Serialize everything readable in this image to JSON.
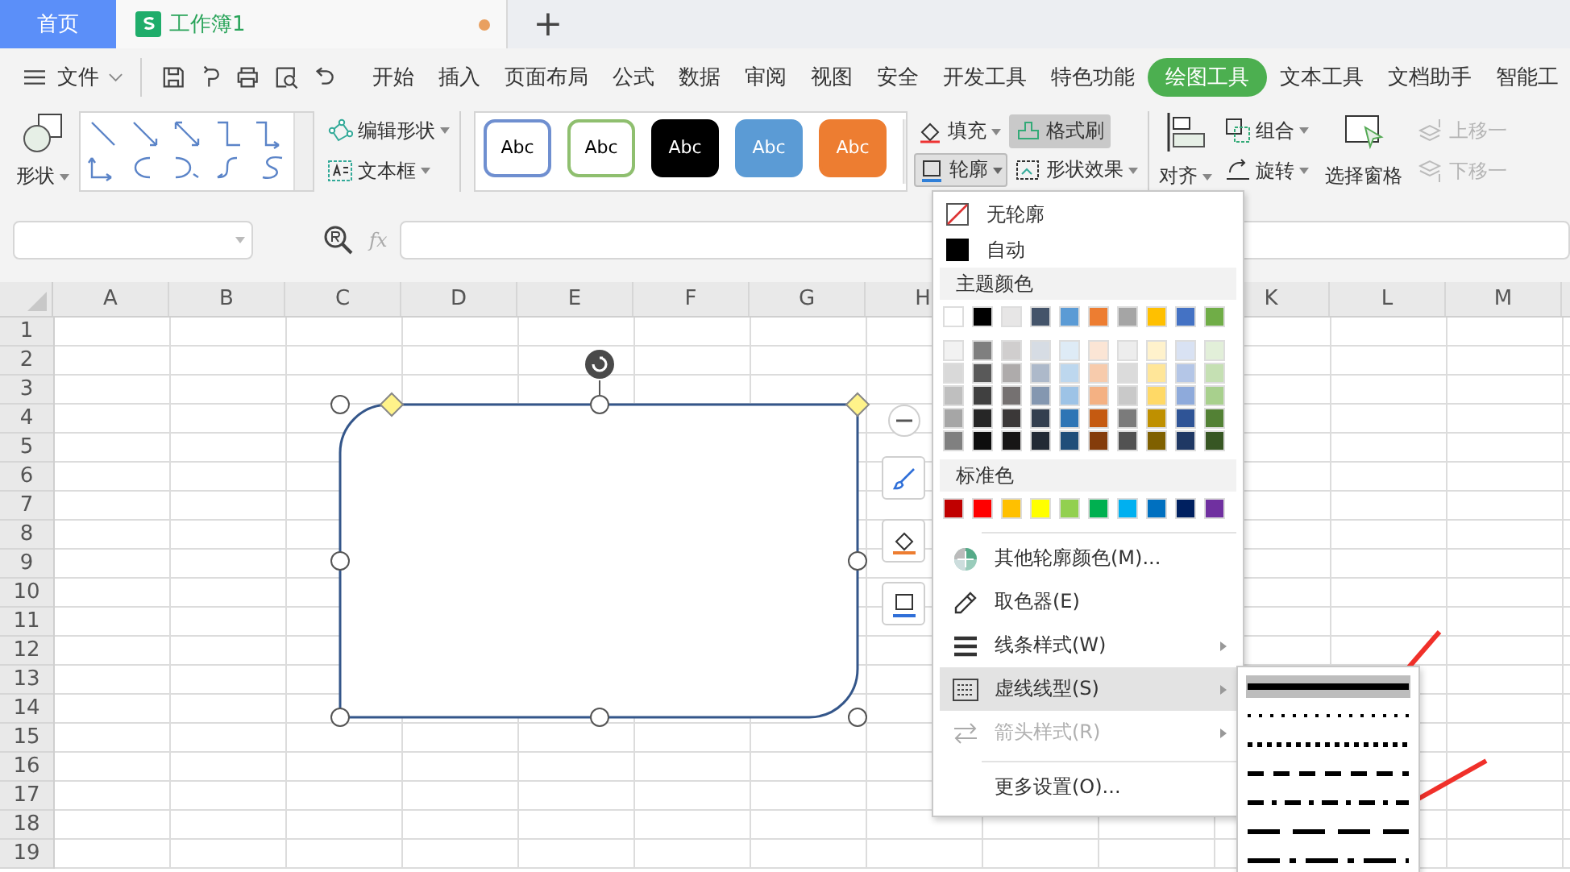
{
  "tabs": [
    {
      "label": "首页",
      "kind": "home",
      "selected": false
    },
    {
      "label": "工作簿1",
      "kind": "doc",
      "selected": true,
      "unsaved": true
    }
  ],
  "new_tab": "+",
  "menu": {
    "file": "文件",
    "items": [
      {
        "label": "开始",
        "selected": false
      },
      {
        "label": "插入",
        "selected": false
      },
      {
        "label": "页面布局",
        "selected": false
      },
      {
        "label": "公式",
        "selected": false
      },
      {
        "label": "数据",
        "selected": false
      },
      {
        "label": "审阅",
        "selected": false
      },
      {
        "label": "视图",
        "selected": false
      },
      {
        "label": "安全",
        "selected": false
      },
      {
        "label": "开发工具",
        "selected": false
      },
      {
        "label": "特色功能",
        "selected": false
      },
      {
        "label": "绘图工具",
        "selected": true
      },
      {
        "label": "文本工具",
        "selected": false
      },
      {
        "label": "文档助手",
        "selected": false
      },
      {
        "label": "智能工",
        "selected": false
      }
    ]
  },
  "ribbon": {
    "shape": "形状",
    "edit_shape": "编辑形状",
    "text_box": "文本框",
    "styles": [
      {
        "label": "Abc",
        "color": "#6f8fd0",
        "filled": false
      },
      {
        "label": "Abc",
        "color": "#8fbf6f",
        "filled": false
      },
      {
        "label": "Abc",
        "color": "#000000",
        "filled": true
      },
      {
        "label": "Abc",
        "color": "#5b9bd5",
        "filled": true
      },
      {
        "label": "Abc",
        "color": "#ed7d31",
        "filled": true
      }
    ],
    "fill": "填充",
    "format_painter": {
      "label": "格式刷",
      "active": true
    },
    "outline": {
      "label": "轮廓",
      "open": true
    },
    "effects": "形状效果",
    "align": "对齐",
    "group": "组合",
    "rotate": "旋转",
    "selection_pane": "选择窗格",
    "bring_forward": {
      "label": "上移一",
      "disabled": true
    },
    "send_backward": {
      "label": "下移一",
      "disabled": true
    }
  },
  "formula_bar": {
    "fx": "fx"
  },
  "sheet": {
    "columns_left": [
      "A",
      "B",
      "C",
      "D",
      "E",
      "F",
      "G",
      "H"
    ],
    "columns_right": [
      "K",
      "L",
      "M"
    ],
    "rows": [
      "1",
      "2",
      "3",
      "4",
      "5",
      "6",
      "7",
      "8",
      "9",
      "10",
      "11",
      "12",
      "13",
      "14",
      "15",
      "16",
      "17",
      "18",
      "19"
    ],
    "shape": {
      "selected": true
    }
  },
  "outline_menu": {
    "no_outline": "无轮廓",
    "automatic": "自动",
    "theme_header": "主题颜色",
    "theme_colors": [
      {
        "color": "#ffffff"
      },
      {
        "color": "#000000"
      },
      {
        "color": "#e7e6e6"
      },
      {
        "color": "#44546a"
      },
      {
        "color": "#5b9bd5"
      },
      {
        "color": "#ed7d31"
      },
      {
        "color": "#a5a5a5"
      },
      {
        "color": "#ffc000"
      },
      {
        "color": "#4472c4"
      },
      {
        "color": "#70ad47"
      }
    ],
    "theme_shades": [
      {
        "swatches": [
          {
            "color": "#f2f2f2"
          },
          {
            "color": "#7f7f7f"
          },
          {
            "color": "#d0cece"
          },
          {
            "color": "#d6dce4"
          },
          {
            "color": "#deebf6"
          },
          {
            "color": "#fbe5d5"
          },
          {
            "color": "#ededed"
          },
          {
            "color": "#fff2cc"
          },
          {
            "color": "#d9e2f3"
          },
          {
            "color": "#e2efd9"
          }
        ]
      },
      {
        "swatches": [
          {
            "color": "#d9d9d9"
          },
          {
            "color": "#595959"
          },
          {
            "color": "#aeabab"
          },
          {
            "color": "#adb9ca"
          },
          {
            "color": "#bdd7ee"
          },
          {
            "color": "#f7cbac"
          },
          {
            "color": "#dbdbdb"
          },
          {
            "color": "#ffe699"
          },
          {
            "color": "#b4c6e7"
          },
          {
            "color": "#c5e0b3"
          }
        ]
      },
      {
        "swatches": [
          {
            "color": "#bfbfbf"
          },
          {
            "color": "#404040"
          },
          {
            "color": "#757171"
          },
          {
            "color": "#8497b0"
          },
          {
            "color": "#9dc3e6"
          },
          {
            "color": "#f4b183"
          },
          {
            "color": "#c9c9c9"
          },
          {
            "color": "#ffd966"
          },
          {
            "color": "#8eaadb"
          },
          {
            "color": "#a8d08d"
          }
        ]
      },
      {
        "swatches": [
          {
            "color": "#a6a6a6"
          },
          {
            "color": "#262626"
          },
          {
            "color": "#3b3838"
          },
          {
            "color": "#333f4f"
          },
          {
            "color": "#2e75b5"
          },
          {
            "color": "#c55a11"
          },
          {
            "color": "#7b7b7b"
          },
          {
            "color": "#bf9000"
          },
          {
            "color": "#2f5496"
          },
          {
            "color": "#538135"
          }
        ]
      },
      {
        "swatches": [
          {
            "color": "#808080"
          },
          {
            "color": "#0d0d0d"
          },
          {
            "color": "#171616"
          },
          {
            "color": "#222a35"
          },
          {
            "color": "#1f4e79"
          },
          {
            "color": "#843c0b"
          },
          {
            "color": "#525252"
          },
          {
            "color": "#7f6000"
          },
          {
            "color": "#1f3864"
          },
          {
            "color": "#375623"
          }
        ]
      }
    ],
    "standard_header": "标准色",
    "standard_colors": [
      {
        "color": "#c00000"
      },
      {
        "color": "#ff0000"
      },
      {
        "color": "#ffc000"
      },
      {
        "color": "#ffff00"
      },
      {
        "color": "#92d050"
      },
      {
        "color": "#00b050"
      },
      {
        "color": "#00b0f0"
      },
      {
        "color": "#0070c0"
      },
      {
        "color": "#002060"
      },
      {
        "color": "#7030a0"
      }
    ],
    "actions": [
      {
        "label": "其他轮廓颜色(M)...",
        "kind": "more-colors",
        "submenu": false,
        "disabled": false,
        "selected": false
      },
      {
        "label": "取色器(E)",
        "kind": "eyedropper",
        "submenu": false,
        "disabled": false,
        "selected": false
      },
      {
        "label": "线条样式(W)",
        "kind": "line-style",
        "submenu": true,
        "disabled": false,
        "selected": false
      },
      {
        "label": "虚线线型(S)",
        "kind": "dash-type",
        "submenu": true,
        "disabled": false,
        "selected": true
      },
      {
        "label": "箭头样式(R)",
        "kind": "arrow-style",
        "submenu": true,
        "disabled": true,
        "selected": false
      },
      {
        "label": "更多设置(O)...",
        "kind": "more-settings",
        "submenu": false,
        "disabled": false,
        "selected": false
      }
    ]
  },
  "dash_menu": [
    {
      "kind": "solid",
      "selected": true
    },
    {
      "kind": "round-dot",
      "selected": false
    },
    {
      "kind": "square-dot",
      "selected": false
    },
    {
      "kind": "dash",
      "selected": false
    },
    {
      "kind": "dash-dot",
      "selected": false
    },
    {
      "kind": "long-dash",
      "selected": false
    },
    {
      "kind": "long-dash-dot",
      "selected": false
    }
  ]
}
